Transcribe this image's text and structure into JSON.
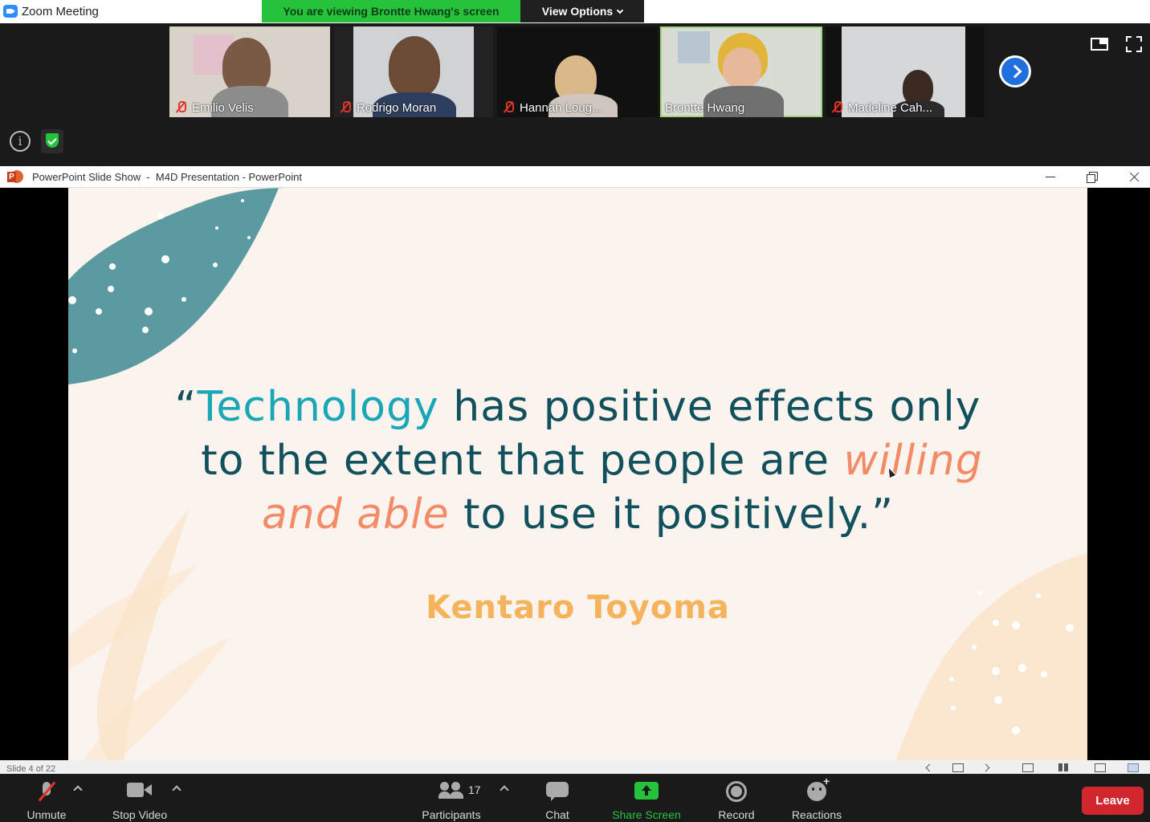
{
  "window": {
    "app_title": "Zoom Meeting"
  },
  "banner": {
    "viewing_text": "You are viewing Brontte Hwang's screen",
    "view_options_label": "View Options"
  },
  "participants_strip": [
    {
      "name": "Emilio Velis",
      "muted": true
    },
    {
      "name": "Rodrigo Moran",
      "muted": true
    },
    {
      "name": "Hannah Loug...",
      "muted": true
    },
    {
      "name": "Brontte Hwang",
      "muted": false,
      "active_speaker": true
    },
    {
      "name": "Madeline Cah...",
      "muted": true
    }
  ],
  "ppt": {
    "window_title": "PowerPoint Slide Show  -  M4D Presentation - PowerPoint",
    "slide": {
      "quote_open": "“",
      "quote_word1": "Technology",
      "quote_part1": " has positive effects only",
      "quote_part2": "to the extent that people are ",
      "quote_accent1": "willing",
      "quote_accent2": "and able",
      "quote_part3": " to use it positively.”",
      "author": "Kentaro Toyoma"
    },
    "status": {
      "slide_indicator": "Slide 4 of 22"
    }
  },
  "toolbar": {
    "unmute_label": "Unmute",
    "stop_video_label": "Stop Video",
    "participants_label": "Participants",
    "participants_count": "17",
    "chat_label": "Chat",
    "share_screen_label": "Share Screen",
    "record_label": "Record",
    "reactions_label": "Reactions",
    "leave_label": "Leave"
  },
  "colors": {
    "share_green": "#27c23c",
    "leave_red": "#d2262e",
    "slide_teal_dark": "#11515d",
    "slide_teal_light": "#1aa7b5",
    "slide_coral": "#f28b66",
    "slide_gold": "#f5b35c",
    "slide_bg": "#faf3ee"
  }
}
